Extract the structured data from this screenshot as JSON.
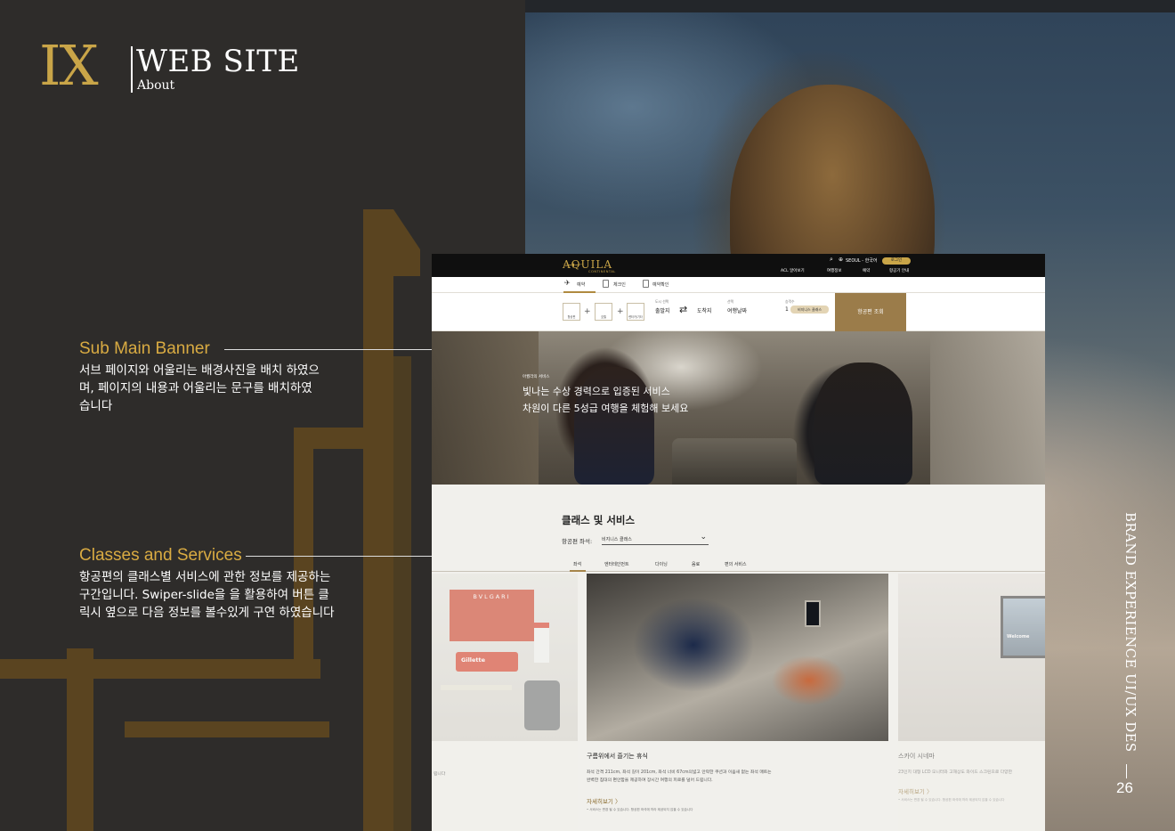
{
  "header": {
    "mark": "IX",
    "title": "WEB SITE",
    "subtitle": "About"
  },
  "annotations": [
    {
      "title": "Sub Main Banner",
      "lines": [
        "서브 페이지와 어울리는 배경사진을 배치 하였으",
        "며, 페이지의 내용과 어울리는 문구를 배치하였",
        "습니다"
      ]
    },
    {
      "title": "Classes and Services",
      "lines": [
        "항공편의 클래스별 서비스에 관한 정보를 제공하는",
        "구간입니다.  Swiper-slide을 을 활용하여 버튼 클",
        "릭시 옆으로 다음 정보를 볼수있게 구연 하였습니다"
      ]
    }
  ],
  "side": {
    "text": "BRAND EXPERIENCE UI/UX DES",
    "page_number": "26"
  },
  "website": {
    "brand": "AQUILA",
    "brand_sub": "CONTINENTAL",
    "util": {
      "location": "SEOUL - 한국어",
      "login": "로그인"
    },
    "gnb": [
      "ACL 알아보기",
      "여행정보",
      "예약",
      "항공기 안내"
    ],
    "tabs": [
      "예약",
      "체크인",
      "예약확인"
    ],
    "booking": {
      "steps": [
        "항공편",
        "호텔",
        "렌터카/기타"
      ],
      "from_label": "도시 선택",
      "from": "출발지",
      "to": "도착지",
      "date_label": "선택",
      "date": "여행날짜",
      "pax_label": "승객수",
      "pax": "1",
      "class": "비지니스 클래스",
      "search": "항공편 조회"
    },
    "banner": {
      "kicker": "아퀼라의 서비스",
      "line1": "빛나는 수상 경력으로 입증된 서비스",
      "line2": "차원이 다른 5성급 여행을 체험해 보세요"
    },
    "classes": {
      "title": "클래스 및 서비스",
      "seat_label": "항공편 좌석:",
      "seat_value": "비지니스 클래스",
      "service_tabs": [
        "좌석",
        "엔터테인먼트",
        "다이닝",
        "음료",
        "편의 서비스"
      ],
      "products": {
        "box_brand": "BVLGARI",
        "can_brand": "Gillette"
      },
      "welcome": "Welcome",
      "cards": [
        {
          "title": "구름위에서 즐기는 휴식",
          "desc1": "좌석 간격 211cm, 좌석 길이 201cm, 좌석 너비 67cm의넓고 안락한 쿠션과 이음새 없는 좌석 매트는",
          "desc2": "완벽한 침대의 편안함을 제공하여 장시간 여행의 피로를 덜어 드립니다.",
          "more": "자세히보기  〉",
          "note": "• 서비스는 변경 될 수 있습니다. 항공편 좌석에 따라 제공되지 않을 수 있습니다"
        },
        {
          "title": "스카이 시네마",
          "desc1": "23인치 대형 LCD 모니터와 고해상도 와이드 스크린으로 다양한",
          "more": "자세히보기  〉",
          "note": "• 서비스는 변경 될 수 있습니다. 항공편 좌석에 따라 제공되지 않을 수 있습니다"
        }
      ],
      "left_card_desc_tail": "립니다"
    }
  },
  "colors": {
    "gold": "#c9a548",
    "annotation_gold": "#d9ab42",
    "dark_bg": "#2e2c2a",
    "search_button": "#9b7c4a"
  }
}
